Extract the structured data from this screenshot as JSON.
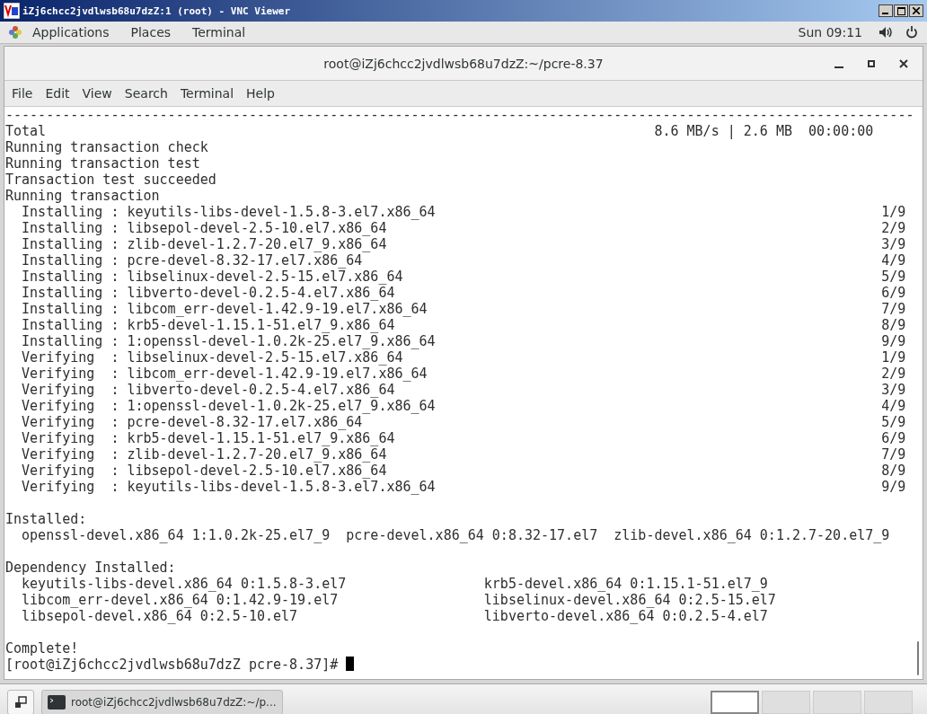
{
  "vnc_window": {
    "title": "iZj6chcc2jvdlwsb68u7dzZ:1 (root) - VNC Viewer"
  },
  "top_bar": {
    "menus": [
      "Applications",
      "Places",
      "Terminal"
    ],
    "clock": "Sun 09:11"
  },
  "terminal": {
    "title": "root@iZj6chcc2jvdlwsb68u7dzZ:~/pcre-8.37",
    "menu": [
      "File",
      "Edit",
      "View",
      "Search",
      "Terminal",
      "Help"
    ],
    "lines": [
      {
        "kind": "plain",
        "text": "----------------------------------------------------------------------------------------------------------------"
      },
      {
        "kind": "total",
        "text": "Total",
        "stat": "8.6 MB/s | 2.6 MB  00:00:00"
      },
      {
        "kind": "plain",
        "text": "Running transaction check"
      },
      {
        "kind": "plain",
        "text": "Running transaction test"
      },
      {
        "kind": "plain",
        "text": "Transaction test succeeded"
      },
      {
        "kind": "plain",
        "text": "Running transaction"
      },
      {
        "kind": "step",
        "text": "Installing : keyutils-libs-devel-1.5.8-3.el7.x86_64",
        "count": "1/9"
      },
      {
        "kind": "step",
        "text": "Installing : libsepol-devel-2.5-10.el7.x86_64",
        "count": "2/9"
      },
      {
        "kind": "step",
        "text": "Installing : zlib-devel-1.2.7-20.el7_9.x86_64",
        "count": "3/9"
      },
      {
        "kind": "step",
        "text": "Installing : pcre-devel-8.32-17.el7.x86_64",
        "count": "4/9"
      },
      {
        "kind": "step",
        "text": "Installing : libselinux-devel-2.5-15.el7.x86_64",
        "count": "5/9"
      },
      {
        "kind": "step",
        "text": "Installing : libverto-devel-0.2.5-4.el7.x86_64",
        "count": "6/9"
      },
      {
        "kind": "step",
        "text": "Installing : libcom_err-devel-1.42.9-19.el7.x86_64",
        "count": "7/9"
      },
      {
        "kind": "step",
        "text": "Installing : krb5-devel-1.15.1-51.el7_9.x86_64",
        "count": "8/9"
      },
      {
        "kind": "step",
        "text": "Installing : 1:openssl-devel-1.0.2k-25.el7_9.x86_64",
        "count": "9/9"
      },
      {
        "kind": "step",
        "text": "Verifying  : libselinux-devel-2.5-15.el7.x86_64",
        "count": "1/9"
      },
      {
        "kind": "step",
        "text": "Verifying  : libcom_err-devel-1.42.9-19.el7.x86_64",
        "count": "2/9"
      },
      {
        "kind": "step",
        "text": "Verifying  : libverto-devel-0.2.5-4.el7.x86_64",
        "count": "3/9"
      },
      {
        "kind": "step",
        "text": "Verifying  : 1:openssl-devel-1.0.2k-25.el7_9.x86_64",
        "count": "4/9"
      },
      {
        "kind": "step",
        "text": "Verifying  : pcre-devel-8.32-17.el7.x86_64",
        "count": "5/9"
      },
      {
        "kind": "step",
        "text": "Verifying  : krb5-devel-1.15.1-51.el7_9.x86_64",
        "count": "6/9"
      },
      {
        "kind": "step",
        "text": "Verifying  : zlib-devel-1.2.7-20.el7_9.x86_64",
        "count": "7/9"
      },
      {
        "kind": "step",
        "text": "Verifying  : libsepol-devel-2.5-10.el7.x86_64",
        "count": "8/9"
      },
      {
        "kind": "step",
        "text": "Verifying  : keyutils-libs-devel-1.5.8-3.el7.x86_64",
        "count": "9/9"
      },
      {
        "kind": "blank"
      },
      {
        "kind": "plain",
        "text": "Installed:"
      },
      {
        "kind": "packages",
        "items": [
          "openssl-devel.x86_64 1:1.0.2k-25.el7_9",
          "pcre-devel.x86_64 0:8.32-17.el7",
          "zlib-devel.x86_64 0:1.2.7-20.el7_9"
        ]
      },
      {
        "kind": "blank"
      },
      {
        "kind": "plain",
        "text": "Dependency Installed:"
      },
      {
        "kind": "columns",
        "left": "keyutils-libs-devel.x86_64 0:1.5.8-3.el7",
        "right": "krb5-devel.x86_64 0:1.15.1-51.el7_9"
      },
      {
        "kind": "columns",
        "left": "libcom_err-devel.x86_64 0:1.42.9-19.el7",
        "right": "libselinux-devel.x86_64 0:2.5-15.el7"
      },
      {
        "kind": "columns",
        "left": "libsepol-devel.x86_64 0:2.5-10.el7",
        "right": "libverto-devel.x86_64 0:0.2.5-4.el7"
      },
      {
        "kind": "blank"
      },
      {
        "kind": "plain",
        "text": "Complete!"
      }
    ],
    "prompt": "[root@iZj6chcc2jvdlwsb68u7dzZ pcre-8.37]#"
  },
  "taskbar": {
    "task": "root@iZj6chcc2jvdlwsb68u7dzZ:~/p...",
    "workspaces": [
      {
        "selected": true
      },
      {
        "selected": false
      },
      {
        "selected": false
      },
      {
        "selected": false
      }
    ]
  }
}
